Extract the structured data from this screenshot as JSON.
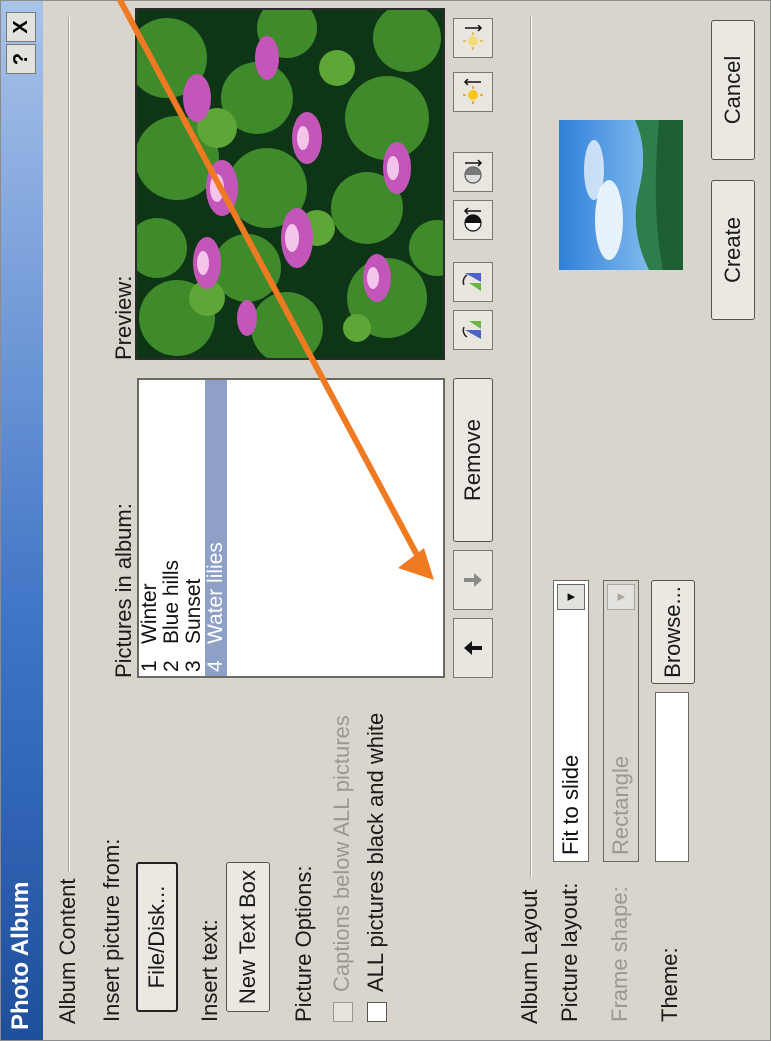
{
  "dialog": {
    "title": "Photo Album",
    "help_label": "?",
    "close_label": "X"
  },
  "album_content": {
    "group_label": "Album Content",
    "insert_picture_label": "Insert picture from:",
    "file_disk_button": "File/Disk...",
    "insert_text_label": "Insert text:",
    "new_text_box_button": "New Text Box",
    "picture_options_label": "Picture Options:",
    "captions_option": "Captions below ALL pictures",
    "bw_option": "ALL pictures black and white",
    "pictures_label": "Pictures in album:",
    "pictures": [
      {
        "num": "1",
        "name": "Winter",
        "selected": false
      },
      {
        "num": "2",
        "name": "Blue hills",
        "selected": false
      },
      {
        "num": "3",
        "name": "Sunset",
        "selected": false
      },
      {
        "num": "4",
        "name": "Water lilies",
        "selected": true
      }
    ],
    "move_up_icon": "up-arrow",
    "move_down_icon": "down-arrow",
    "remove_button": "Remove",
    "preview_label": "Preview:"
  },
  "album_layout": {
    "group_label": "Album Layout",
    "picture_layout_label": "Picture layout:",
    "picture_layout_value": "Fit to slide",
    "frame_shape_label": "Frame shape:",
    "frame_shape_value": "Rectangle",
    "theme_label": "Theme:",
    "theme_value": "",
    "browse_button": "Browse..."
  },
  "buttons": {
    "create": "Create",
    "cancel": "Cancel"
  },
  "colors": {
    "annotation_arrow": "#f07a22",
    "selection": "#8fa0c6",
    "titlebar": "#1d4f9c",
    "dialog_bg": "#d9d5cc"
  }
}
